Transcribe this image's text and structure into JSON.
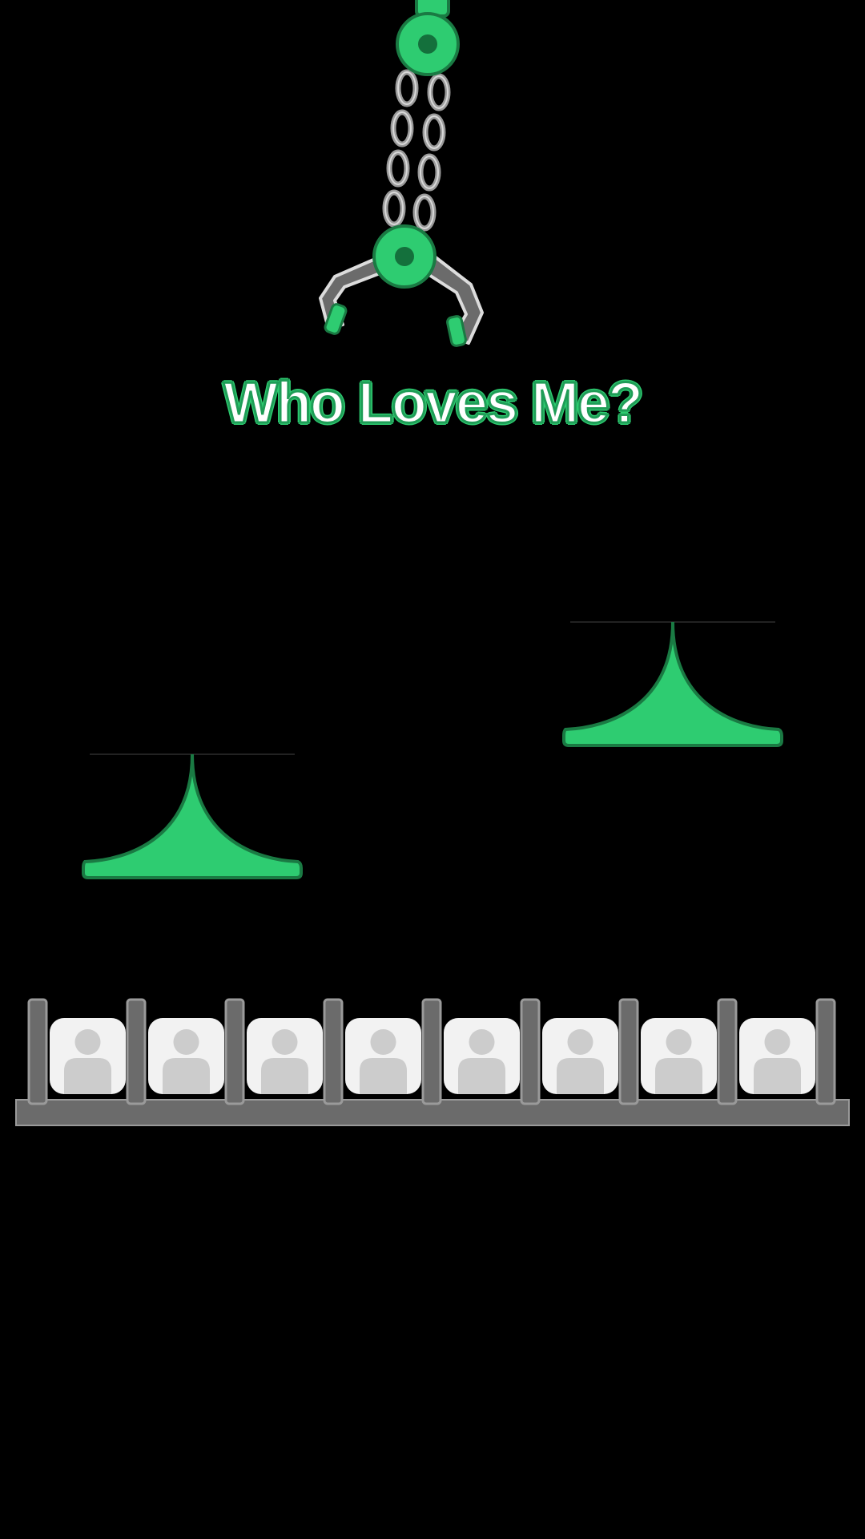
{
  "game": {
    "title": "Who Loves Me?",
    "colors": {
      "accent": "#2ecc71",
      "accent_dark": "#1a7a43",
      "metal": "#6b6b6b",
      "card": "#f2f2f2",
      "avatar": "#cccccc",
      "background": "#000000"
    },
    "claw": {
      "icon": "claw-crane-icon"
    },
    "bumpers": [
      {
        "name": "bumper-left",
        "icon": "bell-bumper-icon"
      },
      {
        "name": "bumper-right",
        "icon": "bell-bumper-icon"
      }
    ],
    "slots": [
      {
        "icon": "user-avatar-icon"
      },
      {
        "icon": "user-avatar-icon"
      },
      {
        "icon": "user-avatar-icon"
      },
      {
        "icon": "user-avatar-icon"
      },
      {
        "icon": "user-avatar-icon"
      },
      {
        "icon": "user-avatar-icon"
      },
      {
        "icon": "user-avatar-icon"
      },
      {
        "icon": "user-avatar-icon"
      }
    ]
  }
}
